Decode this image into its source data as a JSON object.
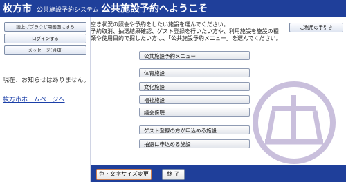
{
  "header": {
    "city": "枚方市",
    "system": "公共施設予約システム",
    "welcome": "公共施設予約へようこそ"
  },
  "sidebar": {
    "buttons": [
      "読上げブラウザ用画面にする",
      "ログインする",
      "メッセージ(通知)"
    ],
    "notice": "現在、お知らせはありません。",
    "homepage_link": "枚方市ホームページへ"
  },
  "main": {
    "instructions": [
      "空き状況の照会や予約をしたい施設を選んでください。",
      "予約取消、抽選結果確認、ゲスト登録を行いたい方や、利用施設を施設の種",
      "類や使用目的で探したい方は、「公共施設予約メニュー」を選んでください。"
    ],
    "help_button": "ご利用の手引き",
    "menu_button": "公共施設予約メニュー",
    "facilities": [
      "体育施設",
      "文化施設",
      "福祉施設",
      "議会傍聴"
    ],
    "extra_buttons": [
      "ゲスト登録の方が申込める施設",
      "抽選に申込める施設"
    ]
  },
  "footer": {
    "color_button": "色・文字サイズ変更",
    "end_button": "終 了"
  },
  "colors": {
    "header_bg": "#1f3f9a",
    "logo": "#c9bfdc"
  }
}
